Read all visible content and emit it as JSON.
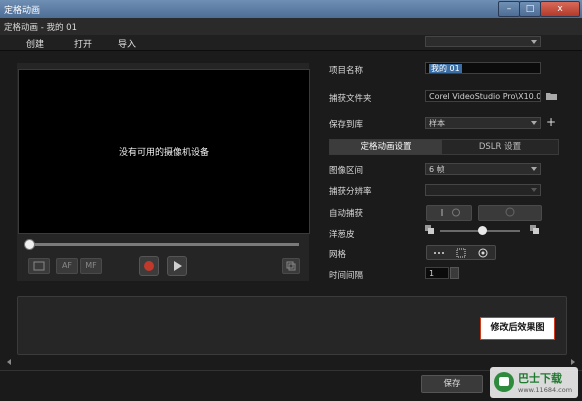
{
  "window": {
    "title": "定格动画",
    "minimize": "–",
    "maximize": "□",
    "close": "x"
  },
  "subheader": {
    "project_path": "定格动画 - 我的 01"
  },
  "menu": {
    "items": [
      "创建",
      "打开",
      "导入"
    ]
  },
  "preview": {
    "message": "没有可用的摄像机设备"
  },
  "controls": {
    "btn_af": "AF",
    "btn_mf": "MF"
  },
  "settings": {
    "project_name_label": "项目名称",
    "project_name_value": "我的 01",
    "capture_folder_label": "捕获文件夹",
    "capture_folder_value": "Corel VideoStudio Pro\\X10.0\\",
    "save_to_label": "保存到库",
    "save_to_value": "样本",
    "tabs": [
      "定格动画设置",
      "DSLR 设置"
    ],
    "image_duration_label": "图像区间",
    "image_duration_value": "6 帧",
    "capture_resolution_label": "捕获分辨率",
    "capture_resolution_value": "",
    "auto_capture_label": "自动捕获",
    "onion_skin_label": "洋葱皮",
    "grid_label": "网格",
    "interval_label": "时间间隔",
    "interval_value": "1"
  },
  "caption": "修改后效果图",
  "footer": {
    "ok_label": "保存"
  },
  "watermark": {
    "text": "巴士下载",
    "url": "www.11684.com"
  },
  "colors": {
    "accent_select": "#3a6ea5",
    "caption_border": "#d23a1a",
    "record_red": "#c0392b"
  }
}
